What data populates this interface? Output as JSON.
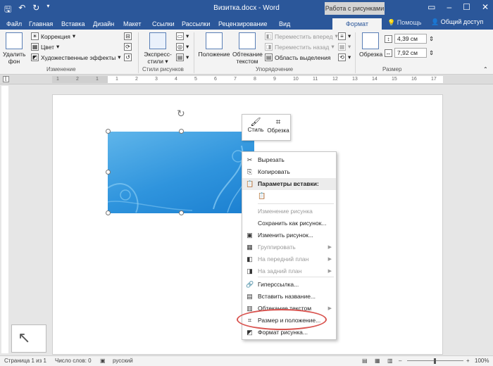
{
  "titlebar": {
    "title": "Визитка.docx - Word",
    "context_tab": "Работа с рисунками"
  },
  "tabs": [
    "Файл",
    "Главная",
    "Вставка",
    "Дизайн",
    "Макет",
    "Ссылки",
    "Рассылки",
    "Рецензирование",
    "Вид",
    "Формат"
  ],
  "active_tab": "Формат",
  "help": "Помощь",
  "share": "Общий доступ",
  "ribbon": {
    "remove_bg": "Удалить фон",
    "correction": "Коррекция",
    "color": "Цвет",
    "art_effects": "Художественные эффекты",
    "group_change": "Изменение",
    "express_styles": "Экспресс-стили",
    "group_styles": "Стили рисунков",
    "position": "Положение",
    "wrap_text": "Обтекание текстом",
    "bring_forward": "Переместить вперед",
    "send_backward": "Переместить назад",
    "selection_pane": "Область выделения",
    "group_arrange": "Упорядочение",
    "crop": "Обрезка",
    "height": "4,39 см",
    "width": "7,92 см",
    "group_size": "Размер"
  },
  "ruler_ticks": [
    "1",
    "2",
    "1",
    "1",
    "2",
    "3",
    "4",
    "5",
    "6",
    "7",
    "8",
    "9",
    "10",
    "11",
    "12",
    "13",
    "14",
    "15",
    "16",
    "17"
  ],
  "mini_toolbar": {
    "style": "Стиль",
    "crop": "Обрезка"
  },
  "context_menu": [
    {
      "label": "Вырезать",
      "icon": "✂",
      "enabled": true,
      "submenu": false
    },
    {
      "label": "Копировать",
      "icon": "⎘",
      "enabled": true,
      "submenu": false
    },
    {
      "label": "Параметры вставки:",
      "icon": "📋",
      "enabled": true,
      "submenu": false,
      "header": true
    },
    {
      "label": "",
      "icon": "📋",
      "enabled": true,
      "submenu": false
    },
    {
      "label": "Изменение рисунка",
      "icon": "",
      "enabled": false,
      "submenu": false
    },
    {
      "label": "Сохранить как рисунок...",
      "icon": "",
      "enabled": true,
      "submenu": false
    },
    {
      "label": "Изменить рисунок...",
      "icon": "▣",
      "enabled": true,
      "submenu": false
    },
    {
      "label": "Группировать",
      "icon": "▦",
      "enabled": false,
      "submenu": true
    },
    {
      "label": "На передний план",
      "icon": "◧",
      "enabled": false,
      "submenu": true
    },
    {
      "label": "На задний план",
      "icon": "◨",
      "enabled": false,
      "submenu": true
    },
    {
      "label": "Гиперссылка...",
      "icon": "🔗",
      "enabled": true,
      "submenu": false
    },
    {
      "label": "Вставить название...",
      "icon": "▤",
      "enabled": true,
      "submenu": false
    },
    {
      "label": "Обтекание текстом",
      "icon": "▥",
      "enabled": true,
      "submenu": true
    },
    {
      "label": "Размер и положение...",
      "icon": "⌗",
      "enabled": true,
      "submenu": false
    },
    {
      "label": "Формат рисунка...",
      "icon": "◩",
      "enabled": true,
      "submenu": false
    }
  ],
  "status": {
    "page": "Страница 1 из 1",
    "words": "Число слов: 0",
    "lang": "русский",
    "zoom": "100%"
  }
}
